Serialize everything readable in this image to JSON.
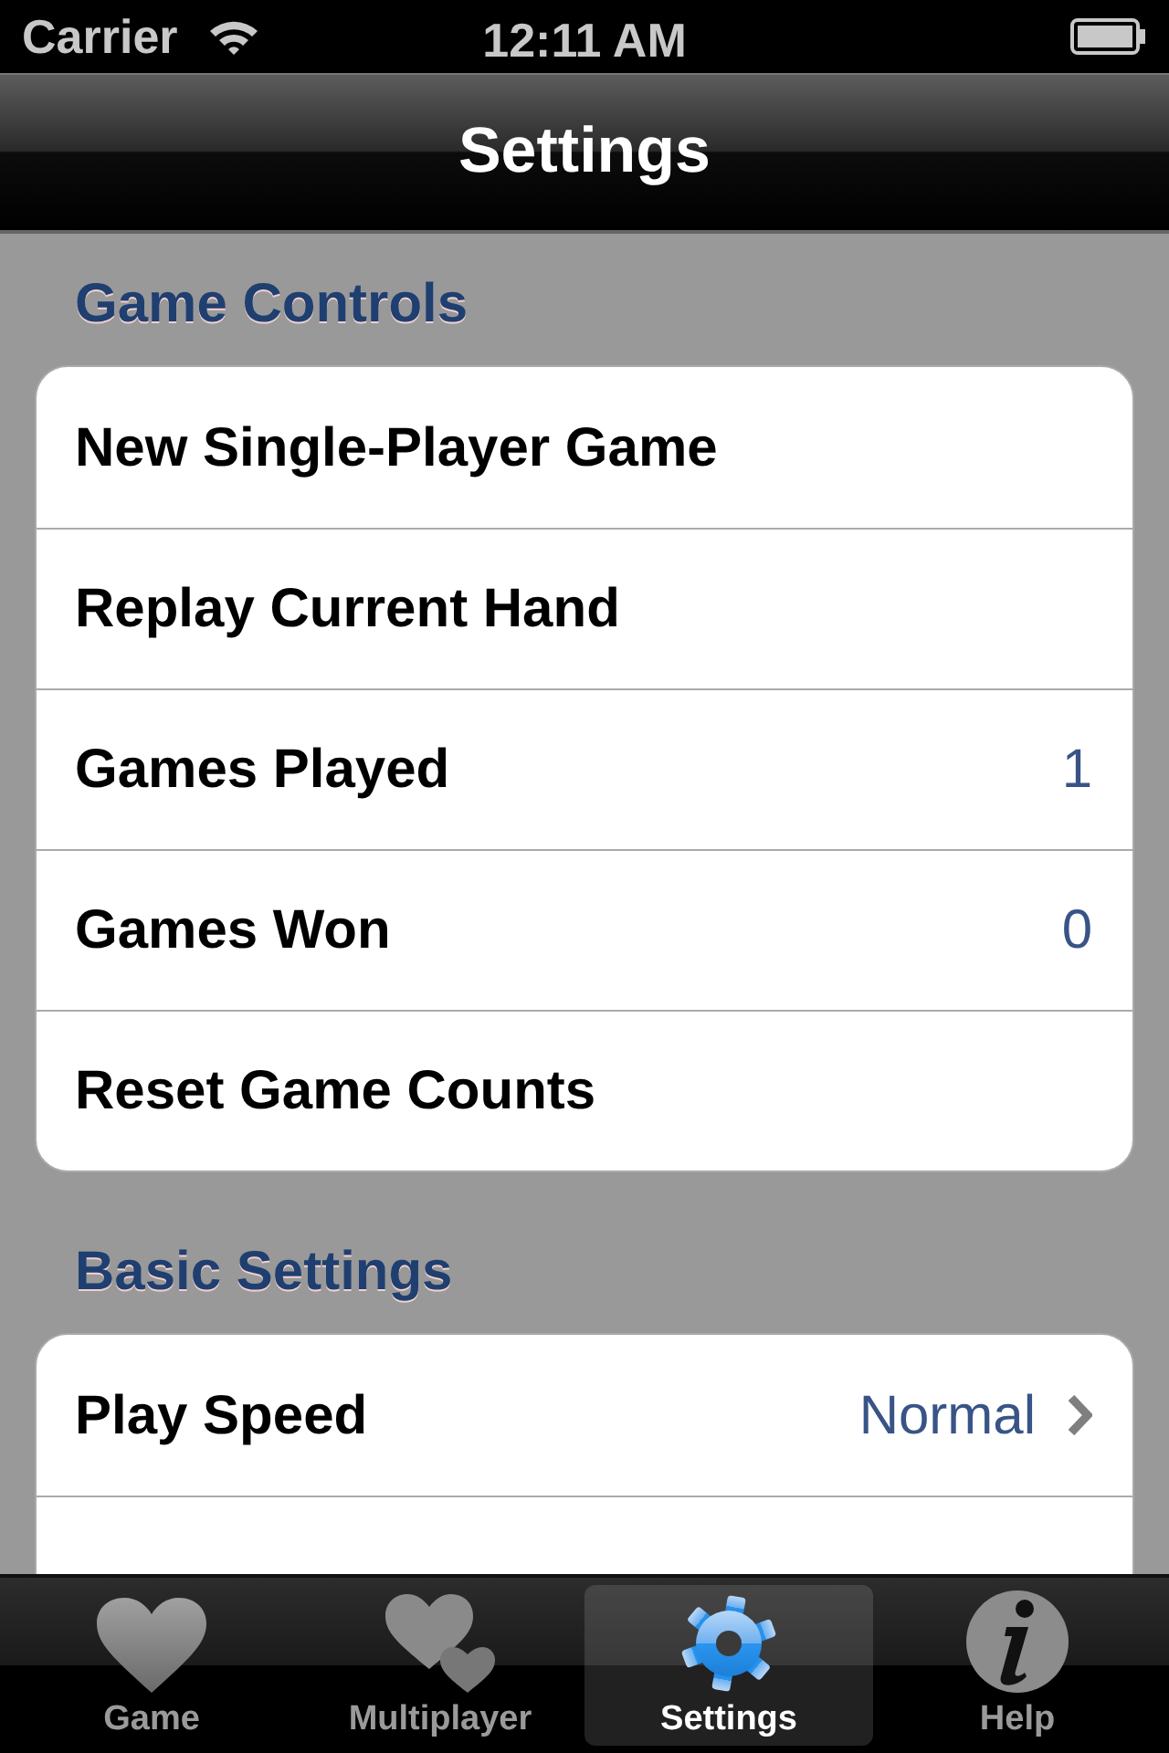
{
  "status_bar": {
    "carrier": "Carrier",
    "time": "12:11 AM"
  },
  "nav_bar": {
    "title": "Settings"
  },
  "sections": [
    {
      "header": "Game Controls",
      "rows": [
        {
          "kind": "action",
          "label": "New Single-Player Game"
        },
        {
          "kind": "action",
          "label": "Replay Current Hand"
        },
        {
          "kind": "count",
          "label": "Games Played",
          "value": "1"
        },
        {
          "kind": "count",
          "label": "Games Won",
          "value": "0"
        },
        {
          "kind": "action",
          "label": "Reset Game Counts"
        }
      ]
    },
    {
      "header": "Basic Settings",
      "rows": [
        {
          "kind": "disclosure",
          "label": "Play Speed",
          "value": "Normal"
        }
      ],
      "continues_below": true
    }
  ],
  "tab_bar": [
    {
      "label": "Game",
      "selected": false
    },
    {
      "label": "Multiplayer",
      "selected": false
    },
    {
      "label": "Settings",
      "selected": true
    },
    {
      "label": "Help",
      "selected": false
    }
  ]
}
